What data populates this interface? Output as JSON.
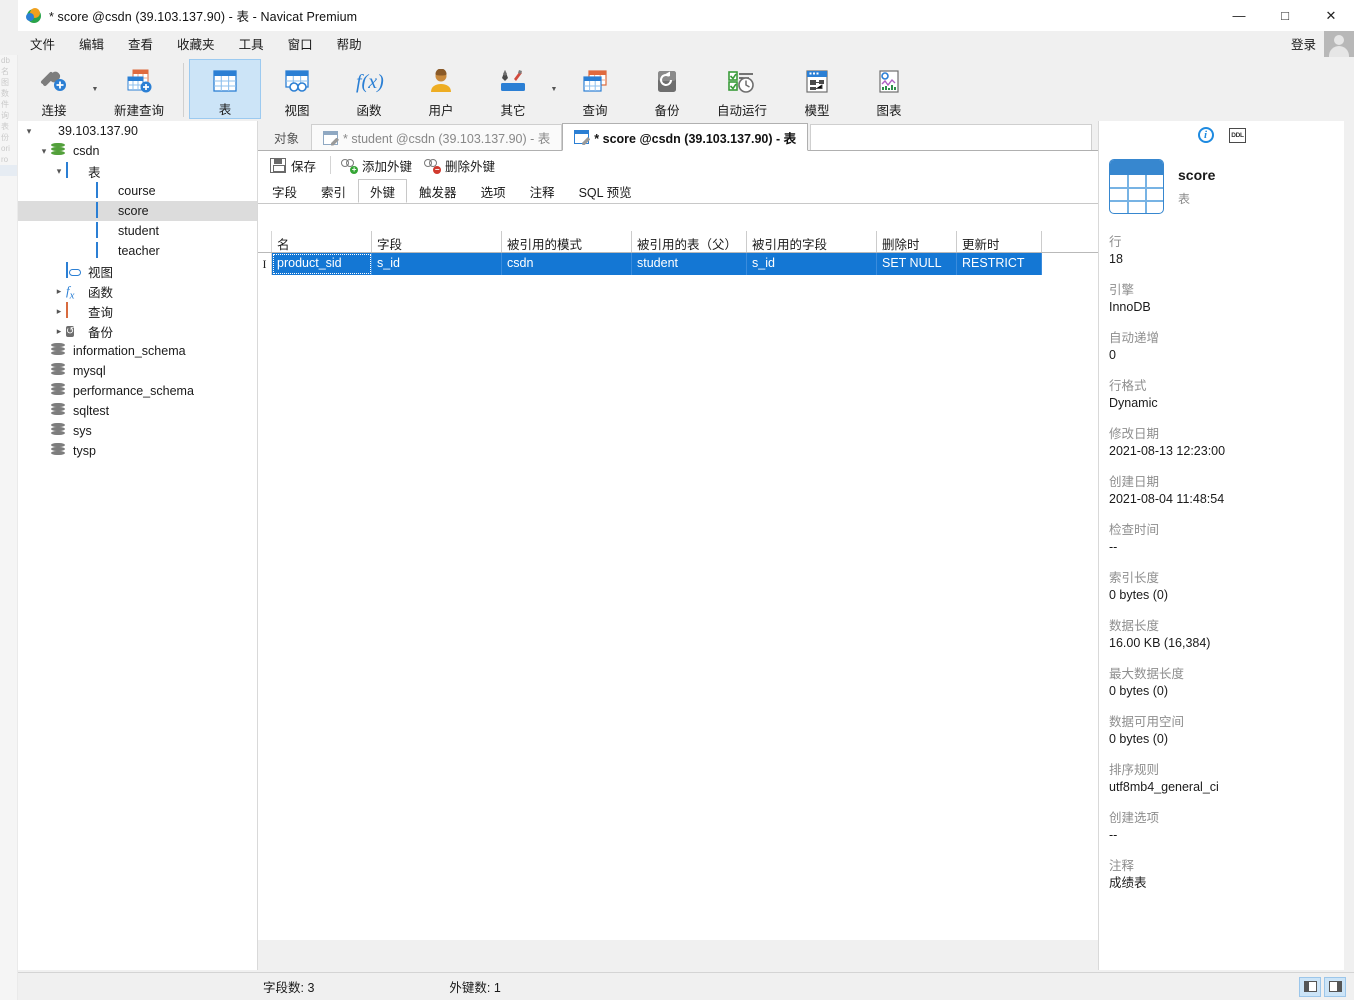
{
  "window": {
    "title": "* score @csdn (39.103.137.90) - 表 - Navicat Premium",
    "minimize": "—",
    "maximize": "□",
    "close": "✕"
  },
  "menubar": {
    "items": [
      "文件",
      "编辑",
      "查看",
      "收藏夹",
      "工具",
      "窗口",
      "帮助"
    ],
    "login_label": "登录"
  },
  "toolbar": {
    "buttons": [
      {
        "label": "连接",
        "icon": "connection-icon",
        "has_caret": true
      },
      {
        "label": "新建查询",
        "icon": "new-query-icon",
        "has_caret": false
      },
      {
        "label": "表",
        "icon": "table-icon",
        "has_caret": false,
        "active": true
      },
      {
        "label": "视图",
        "icon": "view-icon",
        "has_caret": false
      },
      {
        "label": "函数",
        "icon": "function-icon",
        "has_caret": false
      },
      {
        "label": "用户",
        "icon": "user-icon",
        "has_caret": false
      },
      {
        "label": "其它",
        "icon": "other-tools-icon",
        "has_caret": true
      },
      {
        "label": "查询",
        "icon": "query-icon",
        "has_caret": false
      },
      {
        "label": "备份",
        "icon": "backup-icon",
        "has_caret": false
      },
      {
        "label": "自动运行",
        "icon": "automation-icon",
        "has_caret": false
      },
      {
        "label": "模型",
        "icon": "model-icon",
        "has_caret": false
      },
      {
        "label": "图表",
        "icon": "chart-icon",
        "has_caret": false
      }
    ]
  },
  "sidebar": {
    "items": [
      {
        "label": "39.103.137.90",
        "indent": 0,
        "icon": "server-icon",
        "twisty": "open",
        "selected": false
      },
      {
        "label": "csdn",
        "indent": 1,
        "icon": "database-icon",
        "twisty": "open",
        "selected": false
      },
      {
        "label": "表",
        "indent": 2,
        "icon": "table-icon",
        "twisty": "open",
        "selected": false
      },
      {
        "label": "course",
        "indent": 4,
        "icon": "table-icon",
        "twisty": "none",
        "selected": false
      },
      {
        "label": "score",
        "indent": 4,
        "icon": "table-icon",
        "twisty": "none",
        "selected": true
      },
      {
        "label": "student",
        "indent": 4,
        "icon": "table-icon",
        "twisty": "none",
        "selected": false
      },
      {
        "label": "teacher",
        "indent": 4,
        "icon": "table-icon",
        "twisty": "none",
        "selected": false
      },
      {
        "label": "视图",
        "indent": 2,
        "icon": "view-icon",
        "twisty": "none",
        "selected": false
      },
      {
        "label": "函数",
        "indent": 2,
        "icon": "function-icon",
        "twisty": "closed",
        "selected": false
      },
      {
        "label": "查询",
        "indent": 2,
        "icon": "query-icon",
        "twisty": "closed",
        "selected": false
      },
      {
        "label": "备份",
        "indent": 2,
        "icon": "backup-icon",
        "twisty": "closed",
        "selected": false
      },
      {
        "label": "information_schema",
        "indent": 1,
        "icon": "database-grey-icon",
        "twisty": "none",
        "selected": false
      },
      {
        "label": "mysql",
        "indent": 1,
        "icon": "database-grey-icon",
        "twisty": "none",
        "selected": false
      },
      {
        "label": "performance_schema",
        "indent": 1,
        "icon": "database-grey-icon",
        "twisty": "none",
        "selected": false
      },
      {
        "label": "sqltest",
        "indent": 1,
        "icon": "database-grey-icon",
        "twisty": "none",
        "selected": false
      },
      {
        "label": "sys",
        "indent": 1,
        "icon": "database-grey-icon",
        "twisty": "none",
        "selected": false
      },
      {
        "label": "tysp",
        "indent": 1,
        "icon": "database-grey-icon",
        "twisty": "none",
        "selected": false
      }
    ]
  },
  "tabs": {
    "object_tab": "对象",
    "documents": [
      {
        "label": "* student @csdn (39.103.137.90) - 表",
        "active": false
      },
      {
        "label": "* score @csdn (39.103.137.90) - 表",
        "active": true
      }
    ]
  },
  "subtoolbar": {
    "save": "保存",
    "add_fk": "添加外键",
    "delete_fk": "删除外键"
  },
  "page_tabs": {
    "items": [
      "字段",
      "索引",
      "外键",
      "触发器",
      "选项",
      "注释",
      "SQL 预览"
    ],
    "active_index": 2
  },
  "grid": {
    "columns": [
      "名",
      "字段",
      "被引用的模式",
      "被引用的表（父）",
      "被引用的字段",
      "删除时",
      "更新时"
    ],
    "rows": [
      {
        "selected": true,
        "cells": [
          "product_sid",
          "s_id",
          "csdn",
          "student",
          "s_id",
          "SET NULL",
          "RESTRICT"
        ]
      }
    ]
  },
  "info_panel": {
    "table_name": "score",
    "object_type": "表",
    "fields": [
      {
        "label": "行",
        "value": "18"
      },
      {
        "label": "引擎",
        "value": "InnoDB"
      },
      {
        "label": "自动递增",
        "value": "0"
      },
      {
        "label": "行格式",
        "value": "Dynamic"
      },
      {
        "label": "修改日期",
        "value": "2021-08-13 12:23:00"
      },
      {
        "label": "创建日期",
        "value": "2021-08-04 11:48:54"
      },
      {
        "label": "检查时间",
        "value": "--"
      },
      {
        "label": "索引长度",
        "value": "0 bytes (0)"
      },
      {
        "label": "数据长度",
        "value": "16.00 KB (16,384)"
      },
      {
        "label": "最大数据长度",
        "value": "0 bytes (0)"
      },
      {
        "label": "数据可用空间",
        "value": "0 bytes (0)"
      },
      {
        "label": "排序规则",
        "value": "utf8mb4_general_ci"
      },
      {
        "label": "创建选项",
        "value": "--"
      },
      {
        "label": "注释",
        "value": " 成绩表"
      }
    ]
  },
  "statusbar": {
    "field_count": "字段数: 3",
    "fk_count": "外键数: 1"
  },
  "colors": {
    "accent_blue": "#1477d4",
    "toolbar_active": "#cce4f7",
    "chrome_grey": "#f0f0f0",
    "tree_selected": "#dcdcdc"
  }
}
